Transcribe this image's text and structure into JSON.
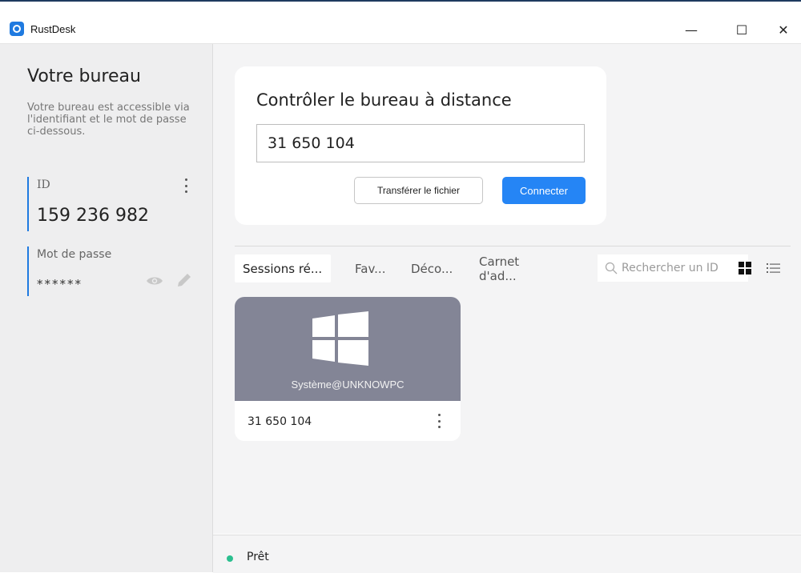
{
  "window": {
    "title": "RustDesk",
    "minimize": "—",
    "maximize": "☐",
    "close": "✕"
  },
  "sidebar": {
    "title": "Votre bureau",
    "description": "Votre bureau est accessible via l'identifiant et le mot de passe ci-dessous.",
    "id_label": "ID",
    "id_value": "159 236 982",
    "password_label": "Mot de passe",
    "password_value": "******"
  },
  "connect": {
    "title": "Contrôler le bureau à distance",
    "input_value": "31 650 104",
    "transfer_button": "Transférer le fichier",
    "connect_button": "Connecter"
  },
  "tabs": [
    {
      "label": "Sessions ré...",
      "active": true
    },
    {
      "label": "Fav...",
      "active": false
    },
    {
      "label": "Déco...",
      "active": false
    },
    {
      "label": "Carnet d'ad...",
      "active": false
    }
  ],
  "search": {
    "placeholder": "Rechercher un ID"
  },
  "peers": [
    {
      "user": "Système@UNKNOWPC",
      "id": "31 650 104",
      "platform_icon": "windows-icon",
      "thumb_color": "#838596"
    }
  ],
  "status": {
    "text": "Prêt",
    "color": "#2bbf8f"
  },
  "colors": {
    "accent": "#2585f5",
    "sidebar_bg": "#eeeeef",
    "main_bg": "#f4f4f5"
  }
}
